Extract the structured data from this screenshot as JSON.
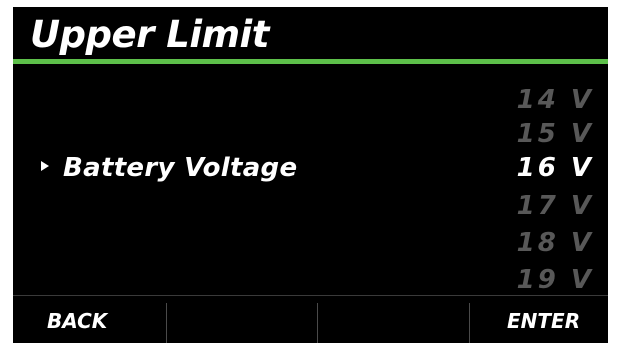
{
  "screen": {
    "title": "Upper Limit",
    "accent_color": "#5dc04a",
    "selected_item": {
      "label": "Battery Voltage",
      "pointer_icon": "triangle-right-icon"
    },
    "value_list": [
      {
        "label": "14 V",
        "selected": false
      },
      {
        "label": "15 V",
        "selected": false
      },
      {
        "label": "16 V",
        "selected": true
      },
      {
        "label": "17 V",
        "selected": false
      },
      {
        "label": "18 V",
        "selected": false
      },
      {
        "label": "19 V",
        "selected": false
      }
    ],
    "softkeys": {
      "back_label": "BACK",
      "key2_label": "",
      "key3_label": "",
      "enter_label": "ENTER"
    }
  }
}
